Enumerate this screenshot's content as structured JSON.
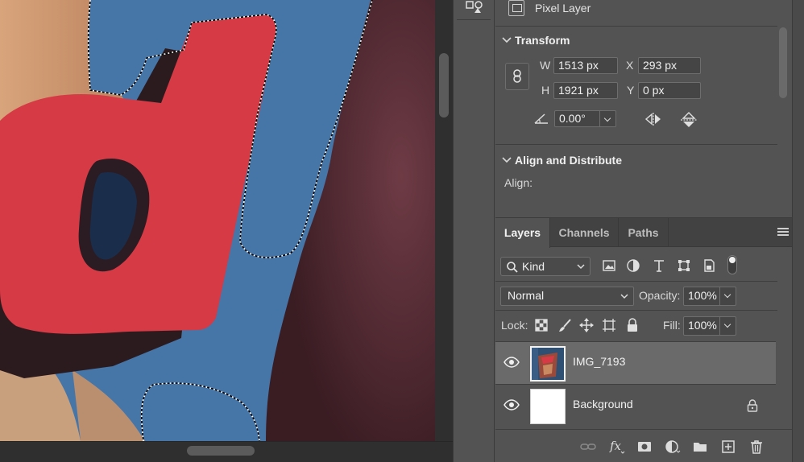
{
  "properties": {
    "layer_type": "Pixel Layer",
    "transform": {
      "heading": "Transform",
      "w_label": "W",
      "w_value": "1513 px",
      "h_label": "H",
      "h_value": "1921 px",
      "x_label": "X",
      "x_value": "293 px",
      "y_label": "Y",
      "y_value": "0 px",
      "angle_value": "0.00°"
    },
    "align": {
      "heading": "Align and Distribute",
      "align_label": "Align:"
    }
  },
  "layers_panel": {
    "tabs": [
      "Layers",
      "Channels",
      "Paths"
    ],
    "active_tab": "Layers",
    "filter_kind": "Kind",
    "blend_mode": "Normal",
    "opacity_label": "Opacity:",
    "opacity_value": "100%",
    "lock_label": "Lock:",
    "fill_label": "Fill:",
    "fill_value": "100%",
    "layers": [
      {
        "name": "IMG_7193",
        "visible": true,
        "selected": true,
        "locked": false
      },
      {
        "name": "Background",
        "visible": true,
        "selected": false,
        "locked": true
      }
    ],
    "bottom_icons": [
      "link-icon",
      "fx-icon",
      "mask-icon",
      "adjustment-icon",
      "folder-icon",
      "new-layer-icon",
      "trash-icon"
    ]
  },
  "colors": {
    "panel_bg": "#535353",
    "selected_layer_bg": "#6a6a6a",
    "canvas_letter_red": "#d53a45",
    "canvas_blue": "#3e6a98"
  }
}
